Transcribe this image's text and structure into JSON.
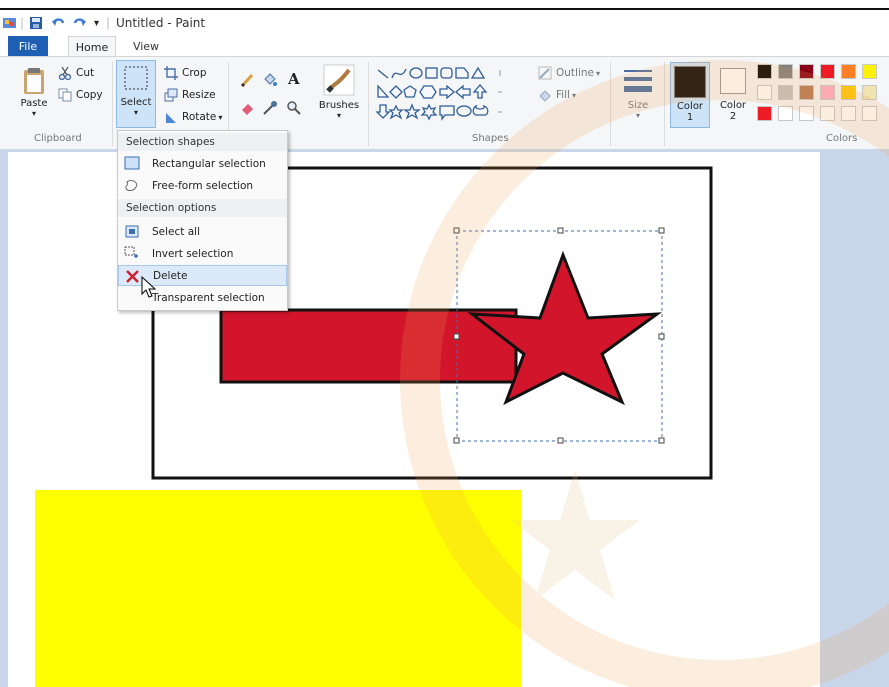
{
  "title_bar": {
    "window_title": "Untitled - Paint",
    "customize_glyph": "▾"
  },
  "tabs": [
    {
      "label": "File"
    },
    {
      "label": "Home"
    },
    {
      "label": "View"
    }
  ],
  "clipboard": {
    "paste_label": "Paste",
    "cut_label": "Cut",
    "copy_label": "Copy",
    "group_label": "Clipboard"
  },
  "image": {
    "select_label": "Select",
    "crop_label": "Crop",
    "resize_label": "Resize",
    "rotate_label": "Rotate"
  },
  "tools": {
    "brushes_label": "Brushes"
  },
  "shapes": {
    "outline_label": "Outline",
    "fill_label": "Fill",
    "group_label": "Shapes"
  },
  "size": {
    "label": "Size"
  },
  "colors": {
    "color1_label": "Color",
    "color1_num": "1",
    "color2_label": "Color",
    "color2_num": "2",
    "group_label": "Colors",
    "color1_value": "#0a0a0a",
    "color2_value": "#ffffff",
    "palette_row1": [
      "#000000",
      "#7f7f7f",
      "#880015",
      "#ed1c24",
      "#ff7f27",
      "#fff200"
    ],
    "palette_row2": [
      "#ffffff",
      "#c3c3c3",
      "#b97a57",
      "#ffaec9",
      "#ffc90e",
      "#efe4b0"
    ],
    "palette_row3_first": "#ed1c24"
  },
  "select_menu": {
    "shapes_header": "Selection shapes",
    "rectangular": "Rectangular selection",
    "freeform": "Free-form selection",
    "options_header": "Selection options",
    "select_all": "Select all",
    "invert": "Invert selection",
    "delete": "Delete",
    "transparent": "Transparent selection"
  },
  "canvas_colors": {
    "red_fill": "#d3152c",
    "yellow_fill": "#ffff00",
    "accent": "#1e5fb4"
  }
}
